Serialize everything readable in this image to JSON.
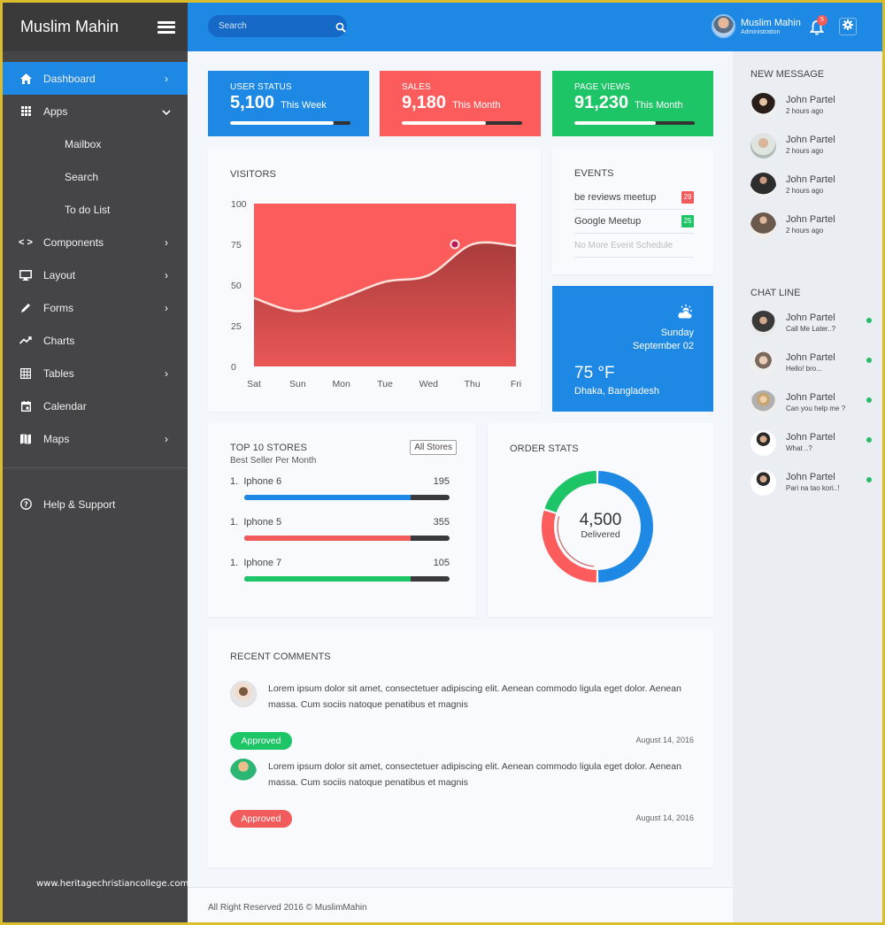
{
  "brand": {
    "name": "Muslim Mahin"
  },
  "search": {
    "placeholder": "Search"
  },
  "user": {
    "name": "Muslim Mahin",
    "role": "Administration",
    "notifications": "5"
  },
  "sidebar": {
    "items": [
      {
        "label": "Dashboard",
        "icon": "home-icon",
        "active": true,
        "chevron": "right"
      },
      {
        "label": "Apps",
        "icon": "apps-grid-icon",
        "chevron": "down"
      },
      {
        "label": "Components",
        "icon": "code-icon",
        "chevron": "right"
      },
      {
        "label": "Layout",
        "icon": "monitor-icon",
        "chevron": "right"
      },
      {
        "label": "Forms",
        "icon": "pencil-icon",
        "chevron": "right"
      },
      {
        "label": "Charts",
        "icon": "trending-icon"
      },
      {
        "label": "Tables",
        "icon": "table-icon",
        "chevron": "right"
      },
      {
        "label": "Calendar",
        "icon": "calendar-icon"
      },
      {
        "label": "Maps",
        "icon": "map-icon",
        "chevron": "right"
      }
    ],
    "apps_sub": [
      "Mailbox",
      "Search",
      "To do List"
    ],
    "help": "Help & Support",
    "watermark": "www.heritagechristiancollege.com"
  },
  "stats": [
    {
      "title": "USER STATUS",
      "value": "5,100",
      "period": "This Week",
      "progress": 0.86,
      "color": "#1e88e5"
    },
    {
      "title": "SALES",
      "value": "9,180",
      "period": "This Month",
      "progress": 0.7,
      "color": "#fc5c5c"
    },
    {
      "title": "PAGE VIEWS",
      "value": "91,230",
      "period": "This Month",
      "progress": 0.68,
      "color": "#1ec566"
    }
  ],
  "visitors": {
    "title": "VISITORS",
    "chart_data": {
      "type": "area",
      "title": "VISITORS",
      "categories": [
        "Sat",
        "Sun",
        "Mon",
        "Tue",
        "Wed",
        "Thu",
        "Fri"
      ],
      "series": [
        {
          "name": "Visitors",
          "values": [
            42,
            34,
            42,
            52,
            56,
            75,
            74
          ]
        }
      ],
      "highlight": {
        "index": 5,
        "value": 75
      },
      "yticks": [
        0,
        25,
        50,
        75,
        100
      ],
      "ylim": [
        0,
        100
      ],
      "grid": false,
      "xlabel": "",
      "ylabel": ""
    }
  },
  "events": {
    "title": "EVENTS",
    "items": [
      {
        "label": "be reviews meetup",
        "badge": "29",
        "color": "#f15b5b"
      },
      {
        "label": "Google Meetup",
        "badge": "25",
        "color": "#1ec566"
      }
    ],
    "empty": "No More Event Schedule"
  },
  "weather": {
    "day": "Sunday",
    "date": "September 02",
    "temp": "75 °F",
    "location": "Dhaka, Bangladesh",
    "icon": "partly-sunny-icon"
  },
  "stores": {
    "title": "TOP 10 STORES",
    "subtitle": "Best Seller Per Month",
    "button": "All Stores",
    "items": [
      {
        "rank": "1.",
        "name": "Iphone 6",
        "value": "195",
        "progress": 0.81,
        "color": "#1e88e5"
      },
      {
        "rank": "1.",
        "name": "Iphone 5",
        "value": "355",
        "progress": 0.81,
        "color": "#f15b5b"
      },
      {
        "rank": "1.",
        "name": "Iphone 7",
        "value": "105",
        "progress": 0.81,
        "color": "#1ec566"
      }
    ]
  },
  "orders": {
    "title": "ORDER STATS",
    "total": "4,500",
    "label": "Delivered",
    "chart_data": {
      "type": "pie",
      "title": "ORDER STATS",
      "segments": [
        {
          "name": "Blue",
          "value": 50,
          "color": "#1e88e5"
        },
        {
          "name": "Red",
          "value": 30,
          "color": "#fc5c5c"
        },
        {
          "name": "Green",
          "value": 20,
          "color": "#1ec566"
        }
      ]
    }
  },
  "comments": {
    "title": "RECENT COMMENTS",
    "items": [
      {
        "text": "Lorem ipsum dolor sit amet, consectetuer adipiscing elit. Aenean commodo ligula eget dolor. Aenean massa. Cum sociis natoque penatibus et magnis",
        "status": "Approved",
        "status_color": "#1ec566",
        "date": "August 14, 2016"
      },
      {
        "text": "Lorem ipsum dolor sit amet, consectetuer adipiscing elit. Aenean commodo ligula eget dolor. Aenean massa. Cum sociis natoque penatibus et magnis",
        "status": "Approved",
        "status_color": "#f15b5b",
        "date": "August 14, 2016"
      }
    ]
  },
  "footer": {
    "text": "All Right Reserved 2016 © MuslimMahin"
  },
  "messages": {
    "title": "NEW MESSAGE",
    "items": [
      {
        "name": "John Partel",
        "time": "2 hours ago"
      },
      {
        "name": "John Partel",
        "time": "2 hours ago"
      },
      {
        "name": "John Partel",
        "time": "2 hours ago"
      },
      {
        "name": "John Partel",
        "time": "2 hours ago"
      }
    ]
  },
  "chat": {
    "title": "CHAT LINE",
    "items": [
      {
        "name": "John Partel",
        "message": "Call Me Later..?",
        "online": true
      },
      {
        "name": "John Partel",
        "message": "Hello! bro...",
        "online": true
      },
      {
        "name": "John Partel",
        "message": "Can you help me ?",
        "online": true
      },
      {
        "name": "John Partel",
        "message": "What ..?",
        "online": true
      },
      {
        "name": "John Partel",
        "message": "Pari na tao kori..!",
        "online": true
      }
    ]
  }
}
